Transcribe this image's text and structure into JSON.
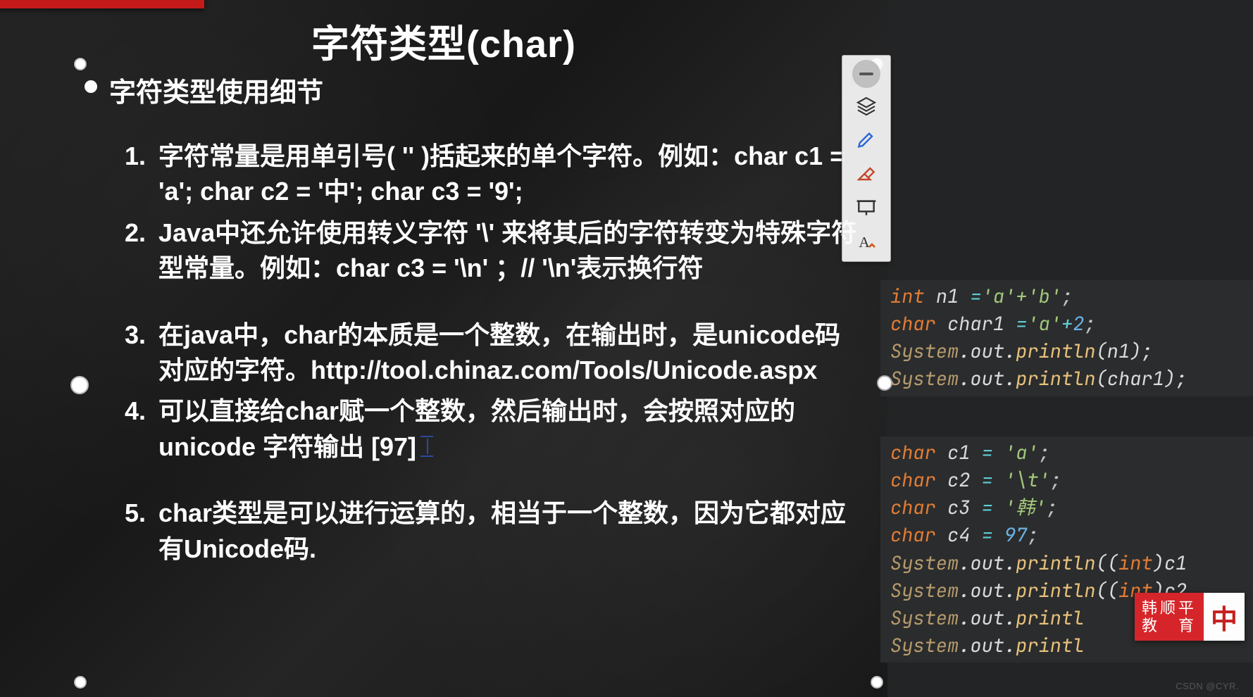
{
  "title": "字符类型(char)",
  "heading": "字符类型使用细节",
  "items": {
    "n1_num": "1.",
    "n1": "字符常量是用单引号( '' )括起来的单个字符。例如：char c1 = 'a';   char c2 = '中'; char c3 =  '9';",
    "n2_num": "2.",
    "n2": "Java中还允许使用转义字符 '\\' 来将其后的字符转变为特殊字符型常量。例如：char c3 =   '\\n' ；// '\\n'表示换行符",
    "n3_num": "3.",
    "n3": "在java中，char的本质是一个整数，在输出时，是unicode码对应的字符。http://tool.chinaz.com/Tools/Unicode.aspx",
    "n4_num": "4.",
    "n4": "可以直接给char赋一个整数，然后输出时，会按照对应的unicode 字符输出 [97]",
    "n5_num": "5.",
    "n5": "char类型是可以进行运算的，相当于一个整数，因为它都对应有Unicode码."
  },
  "toolbar_icons": {
    "close": "close-icon",
    "layers": "layers-icon",
    "highlight": "highlight-icon",
    "eraser": "eraser-icon",
    "presentation": "presentation-icon",
    "text": "text-icon"
  },
  "code1": {
    "l1": {
      "kw": "int",
      "var": "n1",
      "op": "=",
      "str": "'a'+'b'",
      "semi": ";"
    },
    "l2": {
      "kw": "char",
      "var": "char1",
      "op": "=",
      "str": "'a'",
      "plus": "+",
      "num": "2",
      "semi": ";"
    },
    "l3": {
      "sys": "System",
      "rest1": ".out.",
      "meth": "println",
      "args": "(n1);"
    },
    "l4": {
      "sys": "System",
      "rest1": ".out.",
      "meth": "println",
      "args": "(char1);"
    }
  },
  "code2": {
    "l1": {
      "kw": "char",
      "var": "c1",
      "op": "=",
      "str": "'a'",
      "semi": ";"
    },
    "l2": {
      "kw": "char",
      "var": "c2",
      "op": "=",
      "str": "'\\t'",
      "semi": ";"
    },
    "l3": {
      "kw": "char",
      "var": "c3",
      "op": "=",
      "str": "'韩'",
      "semi": ";"
    },
    "l4": {
      "kw": "char",
      "var": "c4",
      "op": "=",
      "num": "97",
      "semi": ";"
    },
    "l5": {
      "sys": "System",
      "rest1": ".out.",
      "meth": "println",
      "args1": "((",
      "cast": "int",
      "args2": ")c1"
    },
    "l6": {
      "sys": "System",
      "rest1": ".out.",
      "meth": "println",
      "args1": "((",
      "cast": "int",
      "args2": ")c2"
    },
    "l7": {
      "sys": "System",
      "rest1": ".out.",
      "meth": "printl"
    },
    "l8": {
      "sys": "System",
      "rest1": ".out.",
      "meth": "printl"
    }
  },
  "ime": {
    "line1": "韩顺平",
    "line2": "教　育",
    "indicator": "中"
  },
  "watermark": "CSDN @CYR."
}
